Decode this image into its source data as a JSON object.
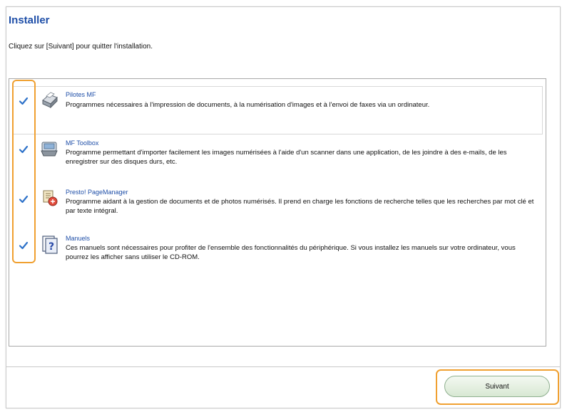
{
  "window": {
    "title": "Installer",
    "instruction": "Cliquez sur [Suivant] pour quitter l'installation."
  },
  "items": [
    {
      "name": "Pilotes MF",
      "description": "Programmes nécessaires à l'impression de documents, à la numérisation d'images et à l'envoi de faxes via un ordinateur.",
      "checked": true,
      "icon": "printer-driver-icon"
    },
    {
      "name": "MF Toolbox",
      "description": "Programme permettant d'importer facilement les images numérisées à l'aide d'un scanner dans une application, de les joindre à des e-mails, de les enregistrer sur des disques durs, etc.",
      "checked": true,
      "icon": "scanner-toolbox-icon"
    },
    {
      "name": "Presto! PageManager",
      "description": "Programme aidant à la gestion de documents et de photos numérisés. Il prend en charge les fonctions de recherche telles que les recherches par mot clé et par texte intégral.",
      "checked": true,
      "icon": "page-manager-icon"
    },
    {
      "name": "Manuels",
      "description": "Ces manuels sont nécessaires pour profiter de l'ensemble des fonctionnalités du périphérique. Si vous installez les manuels sur votre ordinateur, vous pourrez les afficher sans utiliser le CD-ROM.",
      "checked": true,
      "icon": "manual-help-icon"
    }
  ],
  "footer": {
    "next_label": "Suivant"
  },
  "colors": {
    "title": "#1f4fa8",
    "check": "#2e72c9",
    "highlight": "#f0a030"
  }
}
